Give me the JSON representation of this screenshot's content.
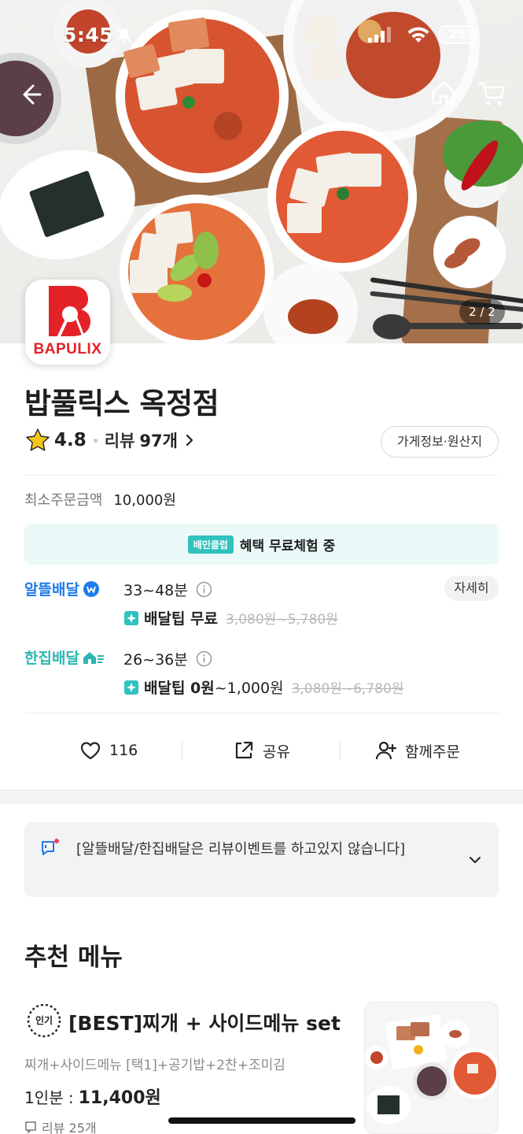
{
  "status_bar": {
    "time": "5:45",
    "battery": "25"
  },
  "hero": {
    "image_counter": "2 / 2"
  },
  "store": {
    "logo_text": "BAPULIX",
    "name": "밥풀릭스 옥정점",
    "rating": "4.8",
    "review_label": "리뷰",
    "review_count": "97개",
    "info_button": "가게정보·원산지"
  },
  "min_order": {
    "label": "최소주문금액",
    "value": "10,000원"
  },
  "club_banner": {
    "badge": "배민클럽",
    "text": "혜택 무료체험 중"
  },
  "delivery": {
    "saver": {
      "label": "알뜰배달",
      "time": "33~48분",
      "tip_label": "배달팁 무료",
      "tip_range": "",
      "tip_original": "3,080원~5,780원"
    },
    "single": {
      "label": "한집배달",
      "time": "26~36분",
      "tip_label": "배달팁 0원",
      "tip_range": "~1,000원",
      "tip_original": "3,080원~6,780원"
    },
    "detail_button": "자세히"
  },
  "actions": {
    "like_count": "116",
    "share_label": "공유",
    "group_order_label": "함께주문"
  },
  "notice": {
    "text": "[알뜰배달/한집배달은 리뷰이벤트를 하고있지 않습니다]"
  },
  "recommended": {
    "title": "추천 메뉴",
    "items": [
      {
        "badge": "인기",
        "name": "[BEST]찌개 + 사이드메뉴 set",
        "description": "찌개+사이드메뉴 [택1]+공기밥+2찬+조미김",
        "price_label": "1인분 :",
        "price": "11,400원",
        "review": "리뷰 25개"
      }
    ]
  },
  "colors": {
    "saver_blue": "#1f7bea",
    "single_teal": "#2eb5b2",
    "club_bg": "#ebf9f8",
    "brand_red": "#e32228",
    "star": "#f5c518"
  },
  "icons": [
    "back-arrow-icon",
    "home-icon",
    "cart-icon",
    "star-icon",
    "chevron-right-icon",
    "info-icon",
    "heart-icon",
    "share-icon",
    "add-user-icon",
    "notice-icon",
    "chevron-down-icon"
  ]
}
